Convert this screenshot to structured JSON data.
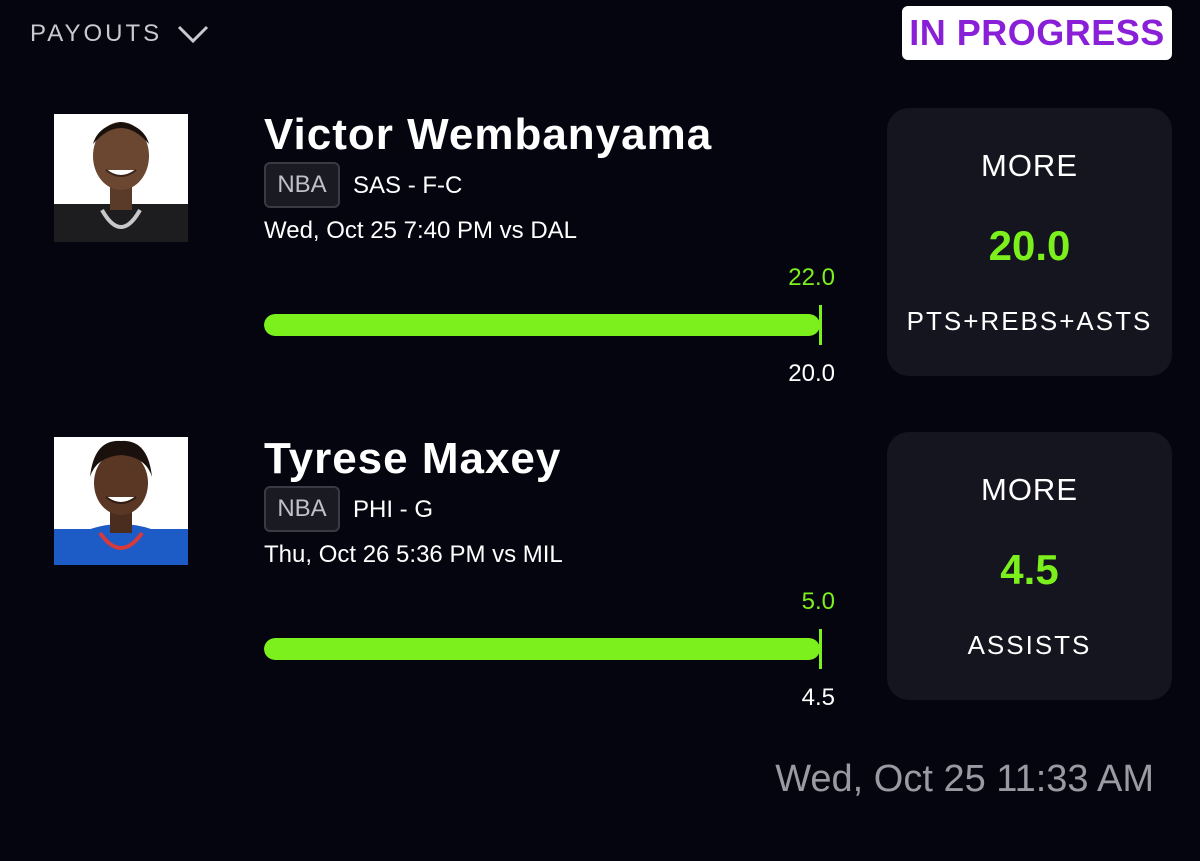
{
  "header": {
    "payouts_label": "PAYOUTS",
    "status_label": "IN PROGRESS"
  },
  "picks": [
    {
      "player": "Victor Wembanyama",
      "league": "NBA",
      "team_position": "SAS - F-C",
      "game": "Wed, Oct 25 7:40 PM  vs DAL",
      "actual": "22.0",
      "line": "20.0",
      "direction": "MORE",
      "projection": "20.0",
      "stat": "PTS+REBS+ASTS",
      "jersey_color": "#1d1d1f",
      "progress_pct": 100
    },
    {
      "player": "Tyrese Maxey",
      "league": "NBA",
      "team_position": "PHI - G",
      "game": "Thu, Oct 26 5:36 PM  vs MIL",
      "actual": "5.0",
      "line": "4.5",
      "direction": "MORE",
      "projection": "4.5",
      "stat": "ASSISTS",
      "jersey_color": "#1d5bc6",
      "progress_pct": 100
    }
  ],
  "timestamp": "Wed, Oct 25 11:33 AM",
  "colors": {
    "accent_green": "#7cf01c",
    "status_purple": "#8a1fd8",
    "background": "#05050f",
    "card": "#15151f"
  }
}
